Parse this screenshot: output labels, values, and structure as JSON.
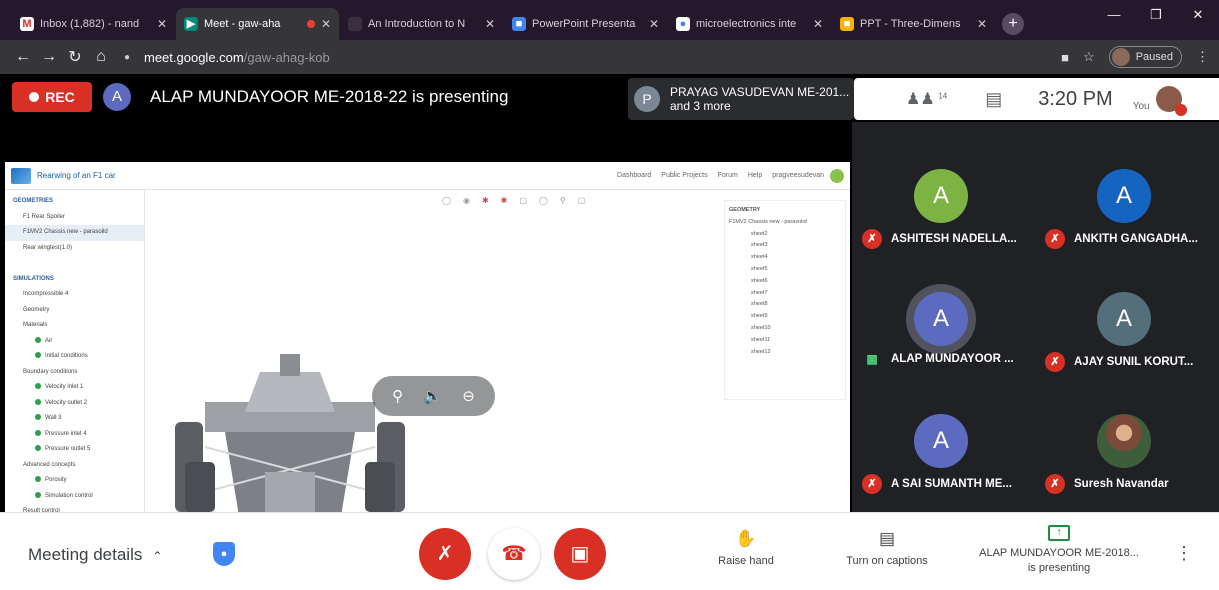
{
  "browser": {
    "tabs": [
      {
        "title": "Inbox (1,882) - nand",
        "icon": "gmail-icon",
        "active": false
      },
      {
        "title": "Meet - gaw-aha",
        "icon": "meet-icon",
        "active": true,
        "recording": true
      },
      {
        "title": "An Introduction to N",
        "icon": "document-icon",
        "active": false
      },
      {
        "title": "PowerPoint Presenta",
        "icon": "powerpoint-icon",
        "active": false
      },
      {
        "title": "microelectronics inte",
        "icon": "google-icon",
        "active": false
      },
      {
        "title": "PPT - Three-Dimens",
        "icon": "slides-icon",
        "active": false
      }
    ],
    "url_host": "meet.google.com",
    "url_path": "/gaw-ahag-kob",
    "profile_label": "Paused"
  },
  "meet": {
    "rec_label": "REC",
    "presenter_initial": "A",
    "presenting_text": "ALAP MUNDAYOOR ME-2018-22 is presenting",
    "others_initial": "P",
    "others_line1": "PRAYAG VASUDEVAN ME-201...",
    "others_line2": "and 3 more",
    "participant_count": "14",
    "time": "3:20 PM",
    "you_label": "You"
  },
  "slide": {
    "app_title": "Rearwing of an F1 car",
    "nav": [
      "Dashboard",
      "Public Projects",
      "Forum",
      "Help",
      "pragveesudevan"
    ],
    "tree": [
      {
        "label": "GEOMETRIES",
        "type": "header"
      },
      {
        "label": "F1 Rear Spoiler",
        "type": "item"
      },
      {
        "label": "F1MV2 Chassis new - parasolid",
        "type": "item",
        "selected": true
      },
      {
        "label": "Rear wingtest(1.0)",
        "type": "item"
      },
      {
        "label": "",
        "type": "gap"
      },
      {
        "label": "SIMULATIONS",
        "type": "header"
      },
      {
        "label": "Incompressible 4",
        "type": "item"
      },
      {
        "label": "Geometry",
        "type": "item"
      },
      {
        "label": "Materials",
        "type": "item"
      },
      {
        "label": "Air",
        "type": "dot"
      },
      {
        "label": "Initial conditions",
        "type": "dot"
      },
      {
        "label": "Boundary conditions",
        "type": "item"
      },
      {
        "label": "Velocity inlet 1",
        "type": "dot"
      },
      {
        "label": "Velocity outlet 2",
        "type": "dot"
      },
      {
        "label": "Wall 3",
        "type": "dot"
      },
      {
        "label": "Pressure inlet 4",
        "type": "dot"
      },
      {
        "label": "Pressure outlet 5",
        "type": "dot"
      },
      {
        "label": "Advanced concepts",
        "type": "item"
      },
      {
        "label": "Porosity",
        "type": "dot"
      },
      {
        "label": "Simulation control",
        "type": "dot"
      },
      {
        "label": "Result control",
        "type": "item"
      }
    ],
    "rpanel_title": "GEOMETRY",
    "rpanel_model": "F1MV2 Chassis new - parasolid",
    "rpanel_items": [
      "sheet2",
      "sheet3",
      "sheet4",
      "sheet5",
      "sheet6",
      "sheet7",
      "sheet8",
      "sheet9",
      "sheet10",
      "sheet11",
      "sheet12"
    ]
  },
  "participants": [
    {
      "initial": "A",
      "name": "ASHITESH NADELLA...",
      "color": "#7cb342",
      "muted": true
    },
    {
      "initial": "A",
      "name": "ANKITH GANGADHA...",
      "color": "#1565c0",
      "muted": true
    },
    {
      "initial": "A",
      "name": "ALAP MUNDAYOOR ...",
      "color": "#5c6bc0",
      "muted": false,
      "speaking": true
    },
    {
      "initial": "A",
      "name": "AJAY SUNIL KORUT...",
      "color": "#546e7a",
      "muted": true
    },
    {
      "initial": "A",
      "name": "A SAI SUMANTH ME...",
      "color": "#5c6bc0",
      "muted": true
    },
    {
      "initial": "",
      "name": "Suresh Navandar",
      "color": "photo",
      "muted": true
    }
  ],
  "bottom": {
    "meeting_details": "Meeting details",
    "raise_hand": "Raise hand",
    "captions": "Turn on captions",
    "present_line1": "ALAP MUNDAYOOR ME-2018...",
    "present_line2": "is presenting"
  },
  "colors": {
    "danger": "#d93025",
    "accent": "#1a73e8",
    "speaking": "#4ecf7a"
  }
}
